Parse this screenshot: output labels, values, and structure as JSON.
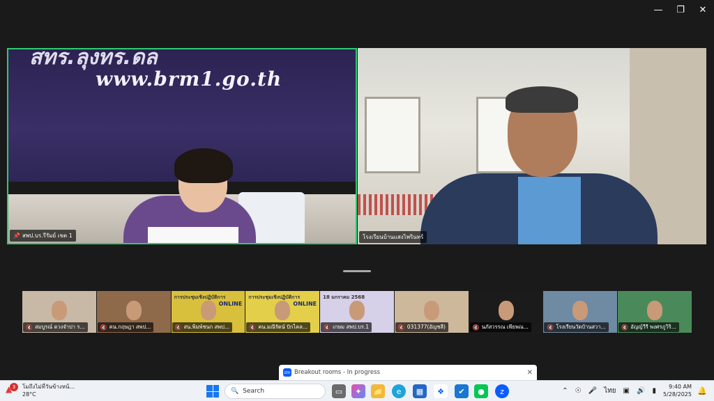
{
  "window": {
    "minimize_icon": "minimize-icon",
    "maximize_icon": "restore-icon",
    "close_icon": "close-icon"
  },
  "main_videos": [
    {
      "name": "สพป.บร.รีรัมย์ เขต 1",
      "banner_text": "www.brm1.go.th",
      "mic": "pin"
    },
    {
      "name": "โรงเรียนบ้านแสงไพรินทร์"
    }
  ],
  "gallery": [
    {
      "name": "สมบูรณ์ ดวงจำปา ร...",
      "bg": "#c7b9a6"
    },
    {
      "name": "คน.กฤษฎา สพป...",
      "bg": "#8e6a4b"
    },
    {
      "name": "สน.พิมพ์ชนก สพป...",
      "bg": "#d8c03c",
      "overlay": "การประชุมเชิงปฏิบัติการ",
      "tag": "ONLINE"
    },
    {
      "name": "คน.มณีรัตน์ ปักไคล...",
      "bg": "#e3cf4a",
      "overlay": "การประชุมเชิงปฏิบัติการ",
      "tag": "ONLINE"
    },
    {
      "name": "เกษม สพป.บร.1",
      "bg": "#d6d0e8",
      "overlay": "18 มกราคม 2568"
    },
    {
      "name": "031377(อัญชลี)",
      "bg": "#cdb89b"
    },
    {
      "name": "นภัสวรรณ เพียพณ...",
      "bg": "#1b1b1b"
    },
    {
      "name": "โรงเรียนวัดบ้านสวา...",
      "bg": "#6f8aa3"
    },
    {
      "name": "อัญญ์วีรี พงศรภูวิริ...",
      "bg": "#4a8a5a"
    }
  ],
  "breakout": {
    "label": "Breakout rooms - In progress",
    "app_badge": "zm"
  },
  "taskbar": {
    "weather_badge": "3",
    "weather_line1": "โมถึงไม่ที่วันข้างหน้...",
    "weather_line2": "28°C",
    "search_placeholder": "Search",
    "tray_lang": "ไทย",
    "time": "9:40 AM",
    "date": "5/28/2025"
  }
}
